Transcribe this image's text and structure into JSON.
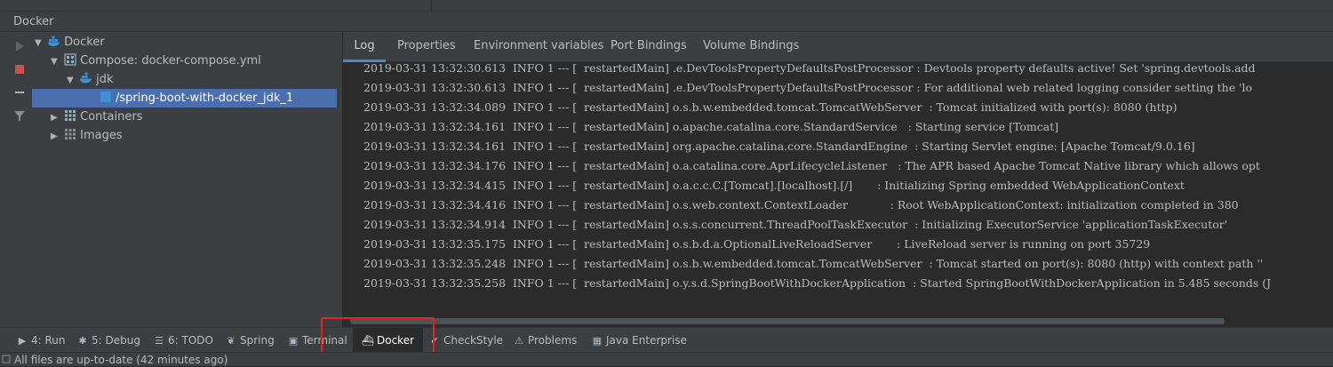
{
  "panel": {
    "title": "Docker"
  },
  "tree": {
    "root": "Docker",
    "compose": "Compose: docker-compose.yml",
    "service": "jdk",
    "container": "/spring-boot-with-docker_jdk_1",
    "containers": "Containers",
    "images": "Images"
  },
  "tabs": [
    "Log",
    "Properties",
    "Environment variables",
    "Port Bindings",
    "Volume Bindings"
  ],
  "log_lines": [
    "2019-03-31 13:32:30.613  INFO 1 --- [  restartedMain] .e.DevToolsPropertyDefaultsPostProcessor : Devtools property defaults active! Set 'spring.devtools.add",
    "2019-03-31 13:32:30.613  INFO 1 --- [  restartedMain] .e.DevToolsPropertyDefaultsPostProcessor : For additional web related logging consider setting the 'lo",
    "2019-03-31 13:32:34.089  INFO 1 --- [  restartedMain] o.s.b.w.embedded.tomcat.TomcatWebServer  : Tomcat initialized with port(s): 8080 (http)",
    "2019-03-31 13:32:34.161  INFO 1 --- [  restartedMain] o.apache.catalina.core.StandardService   : Starting service [Tomcat]",
    "2019-03-31 13:32:34.161  INFO 1 --- [  restartedMain] org.apache.catalina.core.StandardEngine  : Starting Servlet engine: [Apache Tomcat/9.0.16]",
    "2019-03-31 13:32:34.176  INFO 1 --- [  restartedMain] o.a.catalina.core.AprLifecycleListener   : The APR based Apache Tomcat Native library which allows opt",
    "2019-03-31 13:32:34.415  INFO 1 --- [  restartedMain] o.a.c.c.C.[Tomcat].[localhost].[/]       : Initializing Spring embedded WebApplicationContext",
    "2019-03-31 13:32:34.416  INFO 1 --- [  restartedMain] o.s.web.context.ContextLoader            : Root WebApplicationContext: initialization completed in 380",
    "2019-03-31 13:32:34.914  INFO 1 --- [  restartedMain] o.s.s.concurrent.ThreadPoolTaskExecutor  : Initializing ExecutorService 'applicationTaskExecutor'",
    "2019-03-31 13:32:35.175  INFO 1 --- [  restartedMain] o.s.b.d.a.OptionalLiveReloadServer       : LiveReload server is running on port 35729",
    "2019-03-31 13:32:35.248  INFO 1 --- [  restartedMain] o.s.b.w.embedded.tomcat.TomcatWebServer  : Tomcat started on port(s): 8080 (http) with context path ''",
    "2019-03-31 13:32:35.258  INFO 1 --- [  restartedMain] o.y.s.d.SpringBootWithDockerApplication  : Started SpringBootWithDockerApplication in 5.485 seconds (J"
  ],
  "bottom_tools": [
    {
      "label": "4: Run",
      "icon": "run-icon"
    },
    {
      "label": "5: Debug",
      "icon": "debug-icon"
    },
    {
      "label": "6: TODO",
      "icon": "todo-icon"
    },
    {
      "label": "Spring",
      "icon": "spring-icon"
    },
    {
      "label": "Terminal",
      "icon": "terminal-icon"
    },
    {
      "label": "Docker",
      "icon": "docker-icon"
    },
    {
      "label": "CheckStyle",
      "icon": "checkstyle-icon"
    },
    {
      "label": "Problems",
      "icon": "warning-icon"
    },
    {
      "label": "Java Enterprise",
      "icon": "java-enterprise-icon"
    }
  ],
  "status": {
    "text": "All files are up-to-date (42 minutes ago)"
  },
  "colors": {
    "selection": "#4b6eaf",
    "highlight": "#e52421",
    "accent": "#4a88c7",
    "docker": "#3d8fd6"
  }
}
